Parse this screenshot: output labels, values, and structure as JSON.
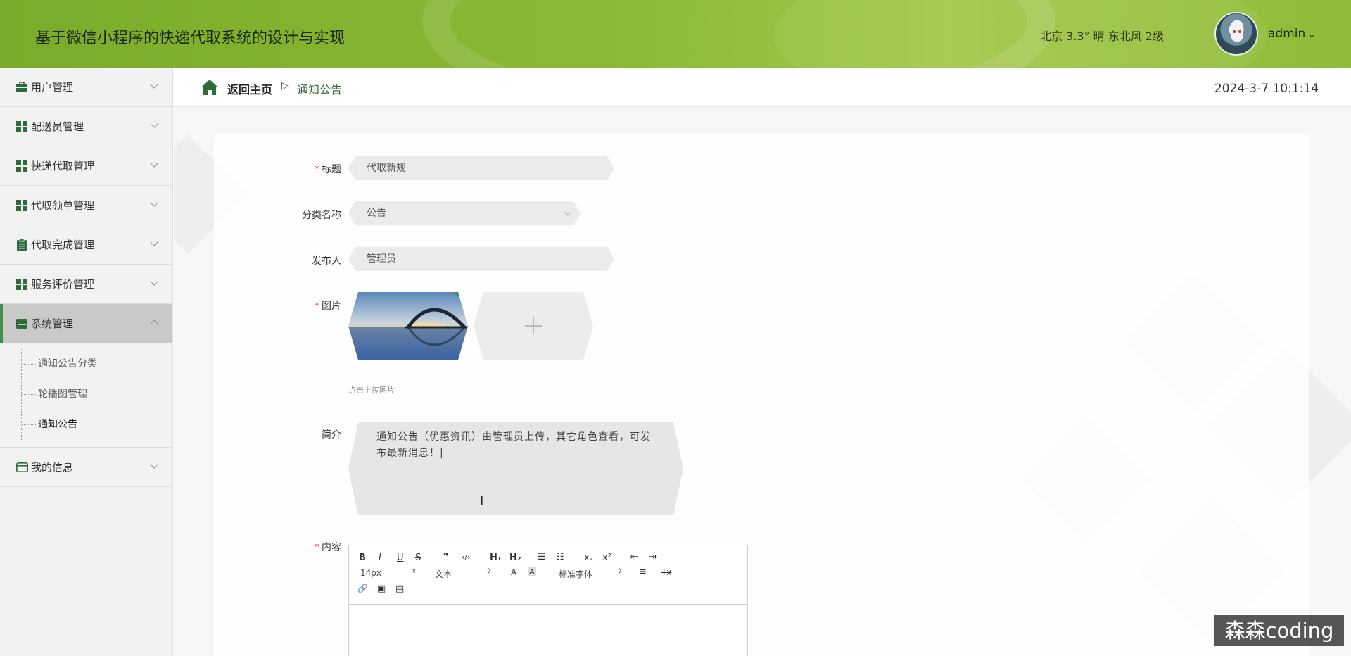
{
  "header": {
    "app_title": "基于微信小程序的快递代取系统的设计与实现",
    "weather": "北京  3.3°  晴  东北风  2级",
    "username": "admin",
    "caret": "⌄"
  },
  "sidebar": {
    "items": [
      {
        "label": "用户管理",
        "icon": "briefcase-icon"
      },
      {
        "label": "配送员管理",
        "icon": "grid-icon"
      },
      {
        "label": "快递代取管理",
        "icon": "grid-icon"
      },
      {
        "label": "代取领单管理",
        "icon": "grid-icon"
      },
      {
        "label": "代取完成管理",
        "icon": "clipboard-icon"
      },
      {
        "label": "服务评价管理",
        "icon": "grid-icon"
      },
      {
        "label": "系统管理",
        "icon": "inbox-icon"
      },
      {
        "label": "我的信息",
        "icon": "card-icon"
      }
    ],
    "sub_items": [
      "通知公告分类",
      "轮播图管理",
      "通知公告"
    ]
  },
  "breadcrumb": {
    "home": "返回主页",
    "separator": "▷",
    "current": "通知公告"
  },
  "datetime": "2024-3-7 10:1:14",
  "form": {
    "title_label": "标题",
    "title_value": "代取新规",
    "category_label": "分类名称",
    "category_value": "公告",
    "publisher_label": "发布人",
    "publisher_value": "管理员",
    "image_label": "图片",
    "upload_hint": "点击上传图片",
    "summary_label": "简介",
    "summary_value": "通知公告（优惠资讯）由管理员上传，其它角色查看，可发布最新消息！|",
    "content_label": "内容",
    "required_mark": "*"
  },
  "editor": {
    "bold": "B",
    "italic": "I",
    "underline": "U",
    "strike": "S",
    "quote": "❞",
    "code": "‹/›",
    "h1": "H₁",
    "h2": "H₂",
    "ol": "☰",
    "ul": "☷",
    "sub": "x₂",
    "sup": "x²",
    "outdent": "⇤",
    "indent": "⇥",
    "size": "14px",
    "format": "文本",
    "font": "标准字体",
    "color": "A",
    "background": "A",
    "align": "≡",
    "clear": "Tx",
    "link": "🔗",
    "image": "▣",
    "video": "▤",
    "arrows": "⇕"
  },
  "watermark": "森森coding",
  "colors": {
    "header_green": "#8ab935",
    "accent_green": "#2f6b3a",
    "required_red": "#ee3333"
  }
}
